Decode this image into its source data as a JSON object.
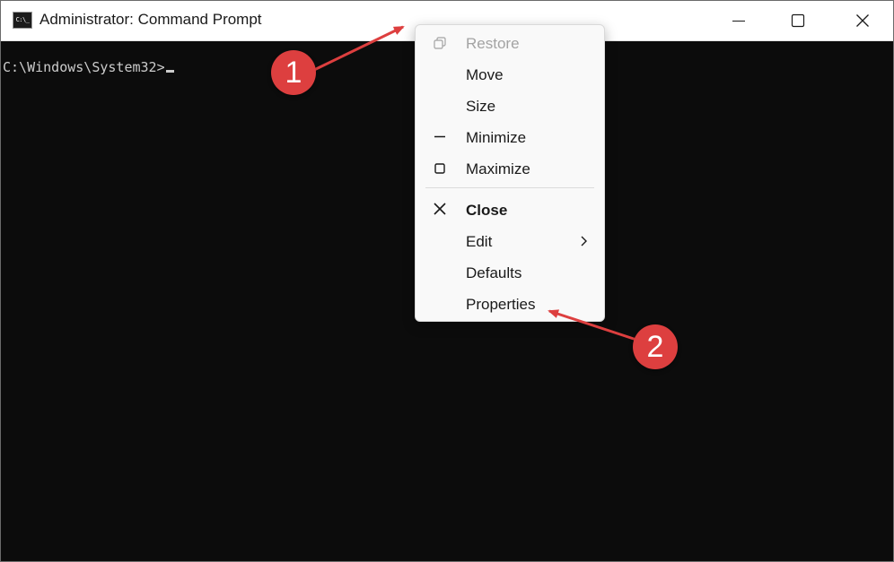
{
  "window": {
    "app_icon_text": "C:\\_",
    "title": "Administrator: Command Prompt"
  },
  "console": {
    "prompt": "C:\\Windows\\System32>"
  },
  "context_menu": {
    "items": [
      {
        "label": "Restore",
        "icon": "restore-icon",
        "disabled": true
      },
      {
        "label": "Move"
      },
      {
        "label": "Size"
      },
      {
        "label": "Minimize",
        "icon": "minimize-icon"
      },
      {
        "label": "Maximize",
        "icon": "maximize-icon"
      },
      {
        "label": "Close",
        "icon": "close-icon",
        "bold": true
      },
      {
        "label": "Edit",
        "submenu": true
      },
      {
        "label": "Defaults"
      },
      {
        "label": "Properties"
      }
    ]
  },
  "annotations": {
    "callout_1": "1",
    "callout_2": "2",
    "color": "#dd3f3f"
  },
  "colors": {
    "console_bg": "#0c0c0c",
    "console_text": "#cccccc",
    "titlebar_bg": "#ffffff",
    "menu_bg": "#f9f9f9"
  }
}
